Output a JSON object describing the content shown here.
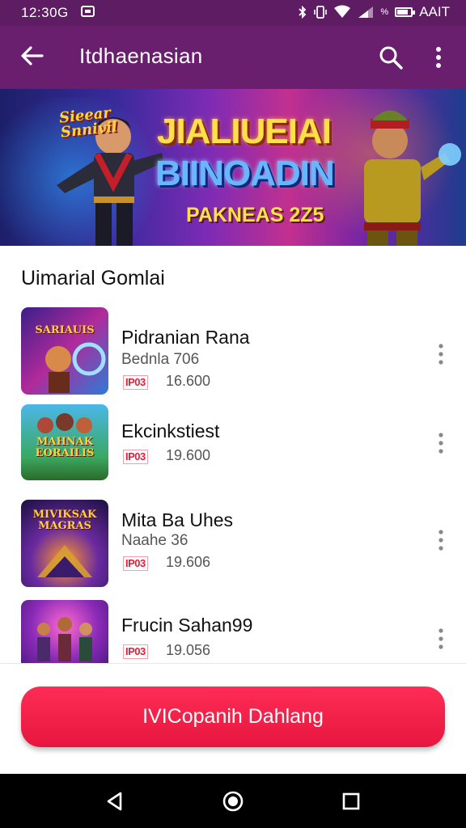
{
  "status": {
    "time": "12:30G",
    "carrier": "AAIT",
    "battery_level": 0.8
  },
  "appbar": {
    "title": "Itdhaenasian"
  },
  "banner": {
    "badge_line1": "Sieear",
    "badge_line2": "Snnivil",
    "headline1": "JIALIUEIAI",
    "headline2": "BIINOADIN",
    "subline": "PAKNEAS 2Z5"
  },
  "section": {
    "title": "Uimarial Gomlai"
  },
  "items": [
    {
      "thumb_text": "SARIAUIS",
      "name": "Pidranian Rana",
      "subtitle": "Bednla 706",
      "tag": "IP03",
      "price": "16.600"
    },
    {
      "thumb_text": "MAHNAK EORAILIS",
      "name": "Ekcinkstiest",
      "subtitle": "",
      "tag": "IP03",
      "price": "19.600"
    },
    {
      "thumb_text": "MIVIKSAK MAGRAS",
      "name": "Mita Ba Uhes",
      "subtitle": "Naahe 36",
      "tag": "IP03",
      "price": "19.606"
    },
    {
      "thumb_text": "",
      "name": "Frucin Sahan99",
      "subtitle": "",
      "tag": "IP03",
      "price": "19.056"
    }
  ],
  "cta": {
    "label": "IVICopanih Dahlang"
  },
  "icons": [
    "back-arrow-icon",
    "search-icon",
    "more-vert-icon",
    "bluetooth-icon",
    "vibrate-icon",
    "wifi-icon",
    "signal-icon",
    "battery-icon",
    "triangle-back-icon",
    "circle-home-icon",
    "square-recents-icon"
  ]
}
